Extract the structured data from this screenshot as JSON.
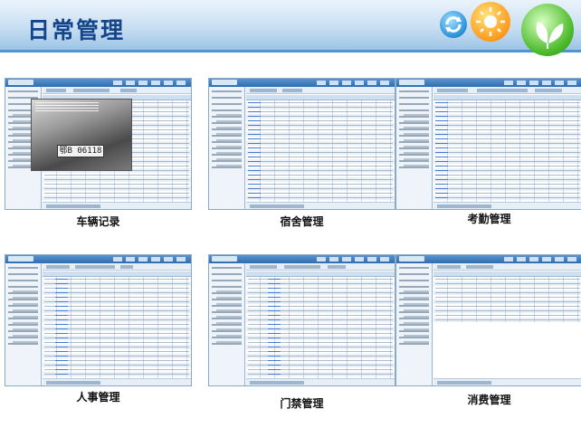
{
  "header": {
    "title": "日常管理"
  },
  "colors": {
    "header_accent": "#4c95d3",
    "title_color": "#14448a",
    "app_bar": "#2f6db0",
    "link_blue": "#2f6fd1"
  },
  "icons": [
    "refresh-logo-icon",
    "sun-logo-icon",
    "leaf-logo-icon"
  ],
  "modules": [
    {
      "label": "车辆记录",
      "plate": "鄂B 06118"
    },
    {
      "label": "宿舍管理"
    },
    {
      "label": "考勤管理"
    },
    {
      "label": "人事管理"
    },
    {
      "label": "门禁管理"
    },
    {
      "label": "消费管理"
    }
  ]
}
